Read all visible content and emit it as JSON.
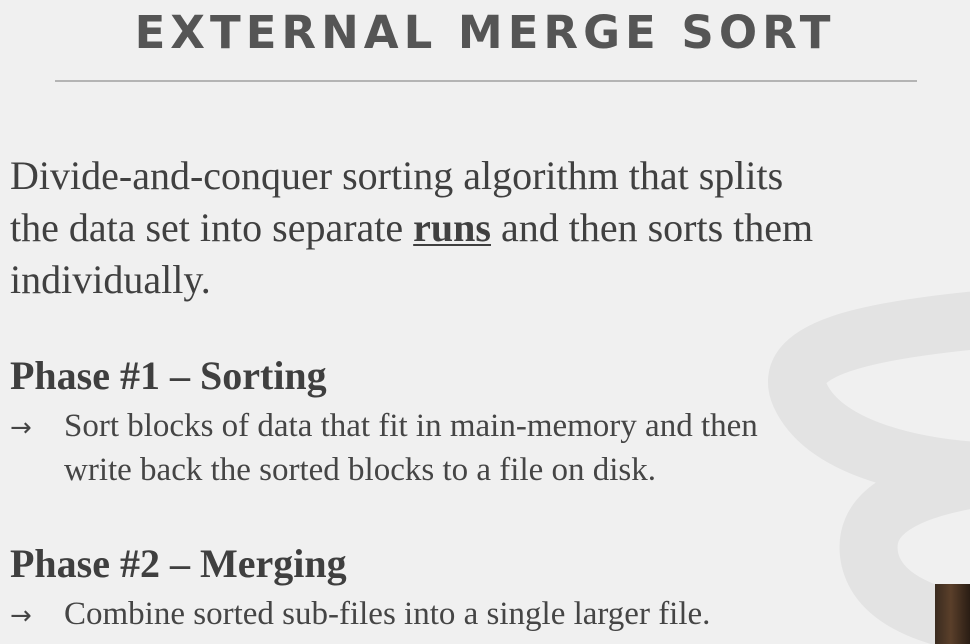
{
  "slide": {
    "title": "EXTERNAL MERGE SORT",
    "intro": {
      "line1": "Divide-and-conquer sorting algorithm that splits",
      "line2_before": "the data set into separate ",
      "line2_keyword": "runs",
      "line2_after": " and then sorts them",
      "line3": "individually."
    },
    "phase1": {
      "heading": "Phase #1 – Sorting",
      "arrow": "→",
      "line1": "Sort blocks of data that fit in main-memory and then",
      "line2": "write back the sorted blocks to a file on disk."
    },
    "phase2": {
      "heading": "Phase #2 – Merging",
      "arrow": "→",
      "line1": "Combine sorted sub-files into a single larger file."
    }
  },
  "colors": {
    "background": "#f0f0f0",
    "title": "#555555",
    "rule": "#b4b4b4",
    "text": "#404040",
    "watermark": "#e2e2e2"
  },
  "icons": {
    "watermark": "database-logo-icon"
  }
}
